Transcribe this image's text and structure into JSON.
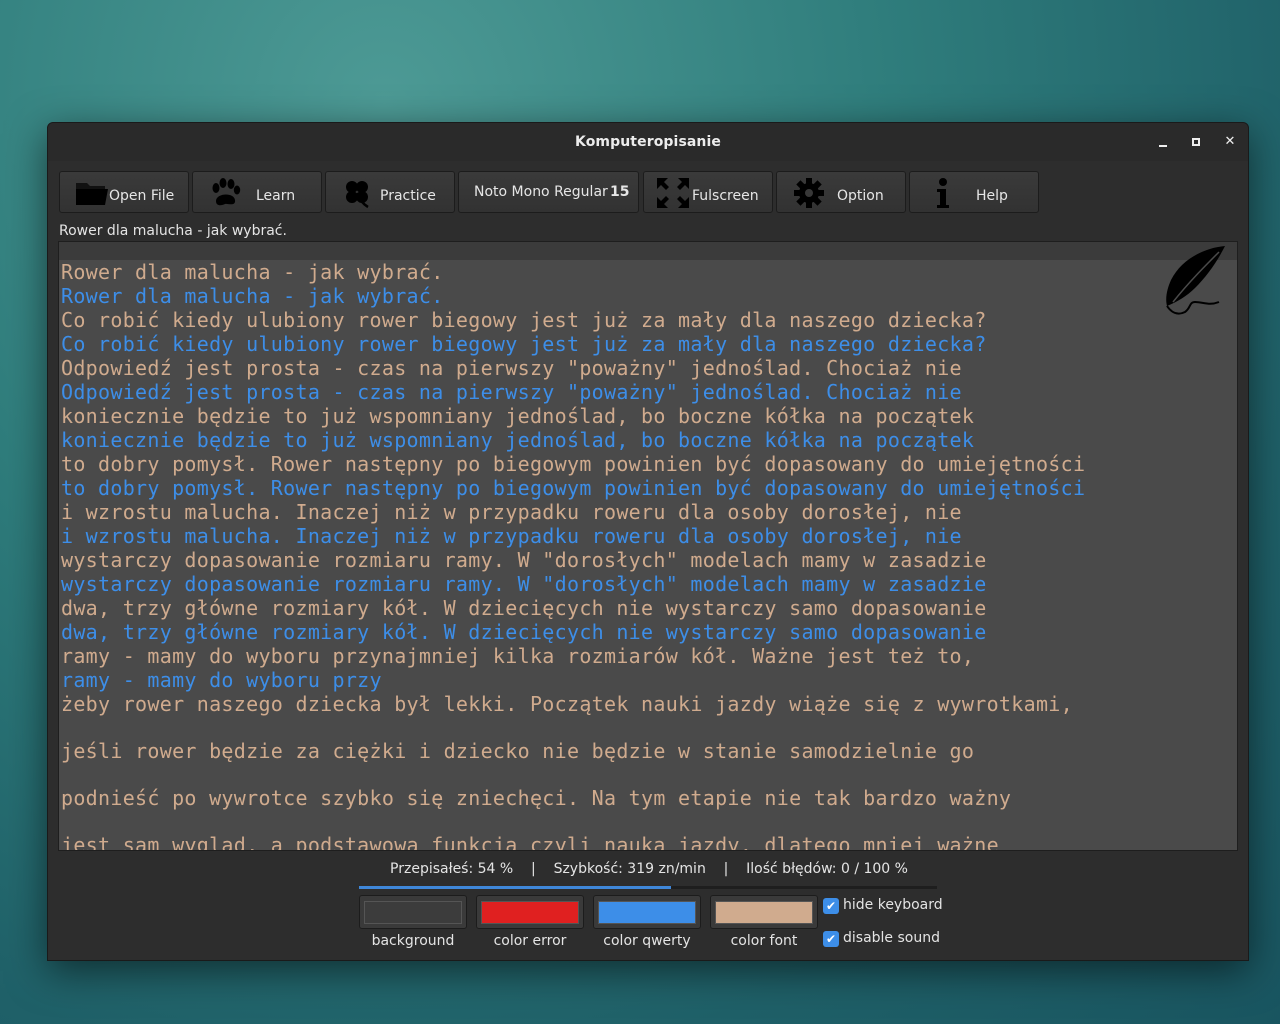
{
  "window": {
    "title": "Komputeropisanie"
  },
  "toolbar": {
    "open_file": "Open File",
    "learn": "Learn",
    "practice": "Practice",
    "font_name": "Noto Mono Regular",
    "font_size": "15",
    "fullscreen": "Fulscreen",
    "option": "Option",
    "help": "Help"
  },
  "file_label": "Rower dla malucha - jak wybrać.",
  "lines": [
    {
      "kind": "src",
      "text": "Rower dla malucha - jak wybrać."
    },
    {
      "kind": "typed",
      "text": "Rower dla malucha - jak wybrać."
    },
    {
      "kind": "src",
      "text": "Co robić kiedy ulubiony rower biegowy jest już za mały dla naszego dziecka?"
    },
    {
      "kind": "typed",
      "text": "Co robić kiedy ulubiony rower biegowy jest już za mały dla naszego dziecka?"
    },
    {
      "kind": "src",
      "text": "Odpowiedź jest prosta - czas na pierwszy \"poważny\" jednoślad. Chociaż nie"
    },
    {
      "kind": "typed",
      "text": "Odpowiedź jest prosta - czas na pierwszy \"poważny\" jednoślad. Chociaż nie"
    },
    {
      "kind": "src",
      "text": "koniecznie będzie to już wspomniany jednoślad, bo boczne kółka na początek"
    },
    {
      "kind": "typed",
      "text": "koniecznie będzie to już wspomniany jednoślad, bo boczne kółka na początek"
    },
    {
      "kind": "src",
      "text": "to dobry pomysł. Rower następny po biegowym powinien być dopasowany do umiejętności"
    },
    {
      "kind": "typed",
      "text": "to dobry pomysł. Rower następny po biegowym powinien być dopasowany do umiejętności"
    },
    {
      "kind": "src",
      "text": "i wzrostu malucha. Inaczej niż w przypadku roweru dla osoby dorosłej, nie"
    },
    {
      "kind": "typed",
      "text": "i wzrostu malucha. Inaczej niż w przypadku roweru dla osoby dorosłej, nie"
    },
    {
      "kind": "src",
      "text": "wystarczy dopasowanie rozmiaru ramy. W \"dorosłych\" modelach mamy w zasadzie"
    },
    {
      "kind": "typed",
      "text": "wystarczy dopasowanie rozmiaru ramy. W \"dorosłych\" modelach mamy w zasadzie"
    },
    {
      "kind": "src",
      "text": "dwa, trzy główne rozmiary kół. W dziecięcych nie wystarczy samo dopasowanie"
    },
    {
      "kind": "typed",
      "text": "dwa, trzy główne rozmiary kół. W dziecięcych nie wystarczy samo dopasowanie"
    },
    {
      "kind": "src",
      "text": "ramy - mamy do wyboru przynajmniej kilka rozmiarów kół. Ważne jest też to,"
    },
    {
      "kind": "typed",
      "text": "ramy - mamy do wyboru przy"
    },
    {
      "kind": "src",
      "text": "żeby rower naszego dziecka był lekki. Początek nauki jazdy wiąże się z wywrotkami,"
    },
    {
      "kind": "gap",
      "text": ""
    },
    {
      "kind": "src",
      "text": "jeśli rower będzie za ciężki i dziecko nie będzie w stanie samodzielnie go"
    },
    {
      "kind": "gap",
      "text": ""
    },
    {
      "kind": "src",
      "text": "podnieść po wywrotce szybko się zniechęci. Na tym etapie nie tak bardzo ważny"
    },
    {
      "kind": "gap",
      "text": ""
    },
    {
      "kind": "src",
      "text": "jest sam wygląd, a podstawowa funkcja czyli nauka jazdy, dlatego mniej ważne"
    }
  ],
  "status": {
    "typed_pct": "Przepisałeś: 54 %",
    "sep1": "|",
    "speed": "Szybkość: 319 zn/min",
    "sep2": "|",
    "errors": "Ilość błędów: 0 / 100 %",
    "progress_fraction": 0.54
  },
  "swatches": [
    {
      "label": "background",
      "color": "#3c3c3c"
    },
    {
      "label": "color error",
      "color": "#e02020"
    },
    {
      "label": "color qwerty",
      "color": "#3d8ee8"
    },
    {
      "label": "color font",
      "color": "#d0ab8e"
    }
  ],
  "options": {
    "hide_keyboard": "hide keyboard",
    "disable_sound": "disable sound",
    "hide_keyboard_checked": true,
    "disable_sound_checked": true
  },
  "icons": [
    "folder-icon",
    "paw-icon",
    "clover-icon",
    "fullscreen-icon",
    "gear-icon",
    "info-icon",
    "feather-icon"
  ]
}
